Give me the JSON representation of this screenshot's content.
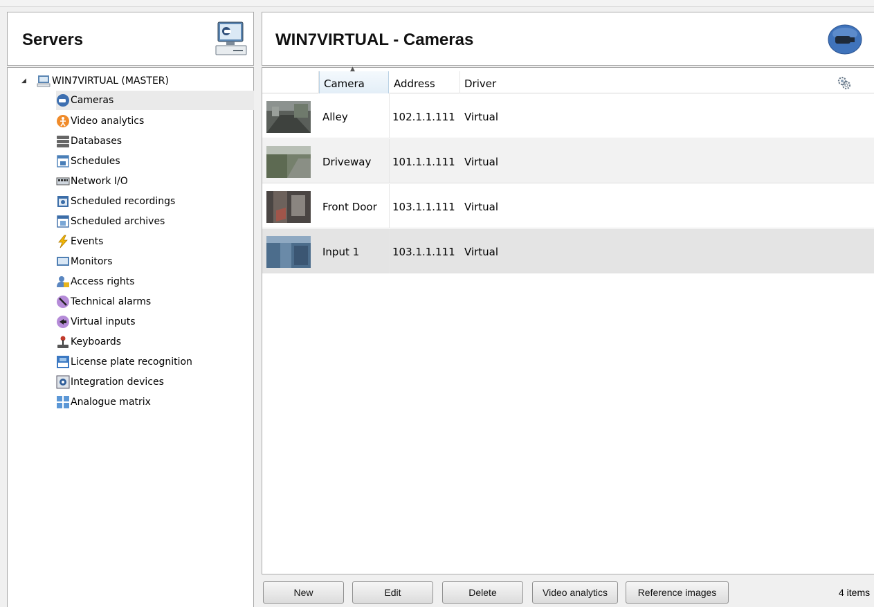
{
  "servers_panel": {
    "title": "Servers"
  },
  "tree": {
    "root_label": "WIN7VIRTUAL (MASTER)",
    "items": [
      {
        "label": "Cameras"
      },
      {
        "label": "Video analytics"
      },
      {
        "label": "Databases"
      },
      {
        "label": "Schedules"
      },
      {
        "label": "Network I/O"
      },
      {
        "label": "Scheduled recordings"
      },
      {
        "label": "Scheduled archives"
      },
      {
        "label": "Events"
      },
      {
        "label": "Monitors"
      },
      {
        "label": "Access rights"
      },
      {
        "label": "Technical alarms"
      },
      {
        "label": "Virtual inputs"
      },
      {
        "label": "Keyboards"
      },
      {
        "label": "License plate recognition"
      },
      {
        "label": "Integration devices"
      },
      {
        "label": "Analogue matrix"
      }
    ]
  },
  "main": {
    "title": "WIN7VIRTUAL - Cameras",
    "columns": {
      "camera": "Camera",
      "address": "Address",
      "driver": "Driver"
    },
    "rows": [
      {
        "name": "Alley",
        "address": "102.1.1.111",
        "driver": "Virtual"
      },
      {
        "name": "Driveway",
        "address": "101.1.1.111",
        "driver": "Virtual"
      },
      {
        "name": "Front Door",
        "address": "103.1.1.111",
        "driver": "Virtual"
      },
      {
        "name": "Input 1",
        "address": "103.1.1.111",
        "driver": "Virtual"
      }
    ]
  },
  "toolbar": {
    "new_label": "New",
    "edit_label": "Edit",
    "delete_label": "Delete",
    "video_analytics_label": "Video analytics",
    "reference_images_label": "Reference images",
    "status": "4 items"
  }
}
